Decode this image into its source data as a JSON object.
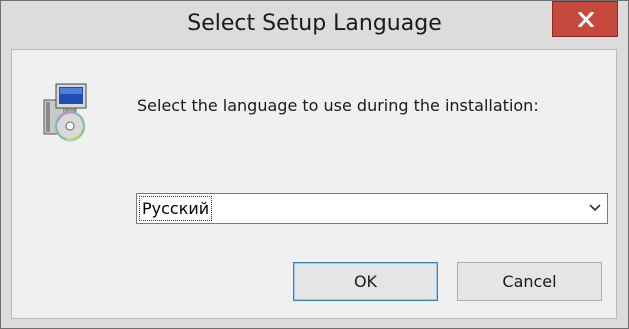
{
  "window": {
    "title": "Select Setup Language",
    "close_icon": "close-icon"
  },
  "dialog": {
    "icon": "setup-installer-icon",
    "prompt": "Select the language to use during the installation:",
    "language_select": {
      "selected": "Русский"
    },
    "buttons": {
      "ok": "OK",
      "cancel": "Cancel"
    }
  },
  "colors": {
    "close_button": "#c7483d",
    "titlebar": "#dcdcdc",
    "client": "#f0f0f0",
    "default_button_border": "#3c7fb1"
  }
}
